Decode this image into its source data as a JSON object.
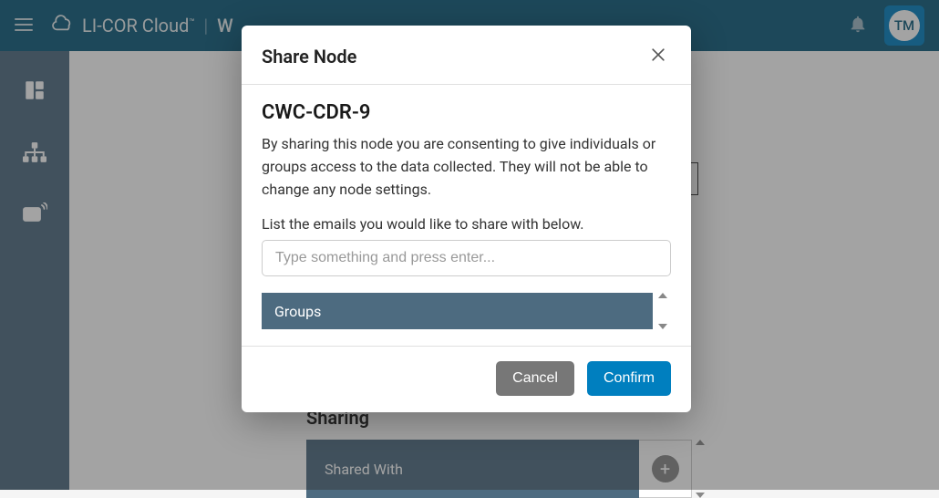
{
  "header": {
    "brand": "LI-COR Cloud",
    "tm": "™",
    "pageInitial": "W",
    "avatar": "TM"
  },
  "bg": {
    "sectionTitle": "Sharing",
    "panelLabel": "Shared With"
  },
  "modal": {
    "title": "Share Node",
    "nodeName": "CWC-CDR-9",
    "description": "By sharing this node you are consenting to give individuals or groups access to the data collected. They will not be able to change any node settings.",
    "instruction": "List the emails you would like to share with below.",
    "placeholder": "Type something and press enter...",
    "groupsLabel": "Groups",
    "cancel": "Cancel",
    "confirm": "Confirm"
  }
}
